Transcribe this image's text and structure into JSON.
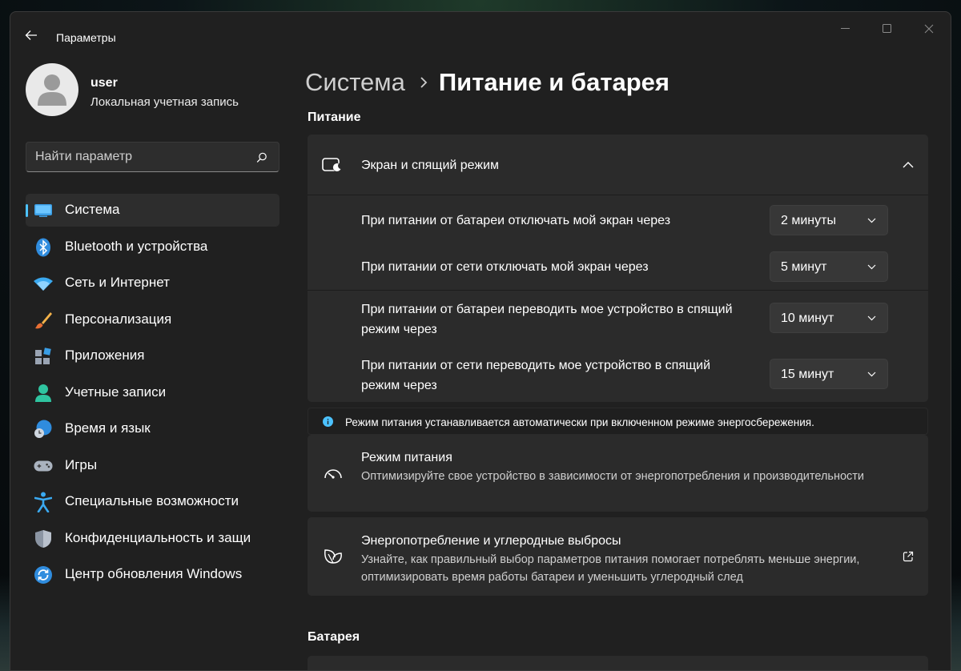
{
  "window": {
    "title": "Параметры"
  },
  "profile": {
    "name": "user",
    "account_type": "Локальная учетная запись"
  },
  "search": {
    "placeholder": "Найти параметр"
  },
  "sidebar": {
    "items": [
      {
        "label": "Система",
        "icon": "system-icon",
        "active": true
      },
      {
        "label": "Bluetooth и устройства",
        "icon": "bluetooth-icon"
      },
      {
        "label": "Сеть и Интернет",
        "icon": "wifi-icon"
      },
      {
        "label": "Персонализация",
        "icon": "brush-icon"
      },
      {
        "label": "Приложения",
        "icon": "apps-icon"
      },
      {
        "label": "Учетные записи",
        "icon": "account-icon"
      },
      {
        "label": "Время и язык",
        "icon": "globe-clock-icon"
      },
      {
        "label": "Игры",
        "icon": "gamepad-icon"
      },
      {
        "label": "Специальные возможности",
        "icon": "accessibility-icon"
      },
      {
        "label": "Конфиденциальность и защи",
        "icon": "shield-icon"
      },
      {
        "label": "Центр обновления Windows",
        "icon": "update-icon"
      }
    ]
  },
  "breadcrumb": {
    "parent": "Система",
    "current": "Питание и батарея"
  },
  "power": {
    "section_title": "Питание",
    "expander": {
      "title": "Экран и спящий режим",
      "rows": [
        {
          "label": "При питании от батареи отключать мой экран через",
          "value": "2 минуты"
        },
        {
          "label": "При питании от сети отключать мой экран через",
          "value": "5 минут"
        },
        {
          "label": "При питании от батареи переводить мое устройство в спящий режим через",
          "value": "10 минут"
        },
        {
          "label": "При питании от сети переводить мое устройство в спящий режим через",
          "value": "15 минут"
        }
      ]
    },
    "info": "Режим питания устанавливается автоматически при включенном режиме энергосбережения.",
    "mode": {
      "title": "Режим питания",
      "description": "Оптимизируйте свое устройство в зависимости от энергопотребления и производительности"
    },
    "energy": {
      "title": "Энергопотребление и углеродные выбросы",
      "description": "Узнайте, как правильный выбор параметров питания помогает потреблять меньше энергии, оптимизировать время работы батареи и уменьшить углеродный след"
    }
  },
  "battery": {
    "section_title": "Батарея"
  },
  "colors": {
    "accent": "#4cc2ff",
    "window_bg": "#202020",
    "card_bg": "#2b2b2b"
  }
}
